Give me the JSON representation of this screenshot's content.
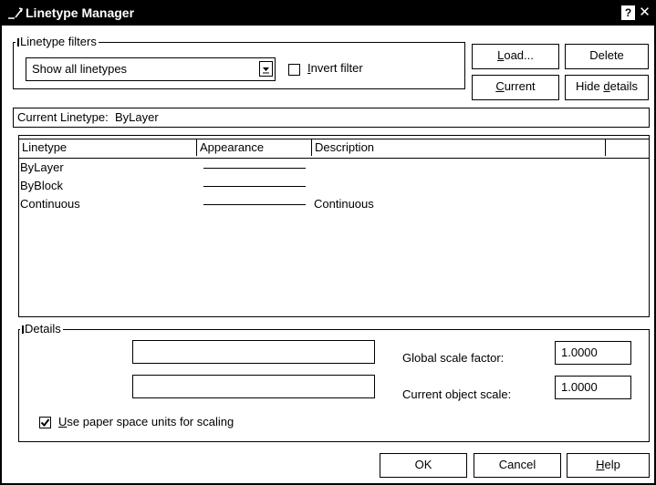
{
  "window": {
    "title": "Linetype Manager",
    "help_glyph": "?",
    "close_glyph": "✕"
  },
  "filters": {
    "legend": "Linetype filters",
    "selected": "Show all linetypes",
    "invert_label_first": "I",
    "invert_label_rest": "nvert filter",
    "invert_checked": false
  },
  "buttons": {
    "load_u": "L",
    "load_rest": "oad...",
    "delete": "Delete",
    "current_u": "C",
    "current_rest": "urrent",
    "hide_details_pre": "Hide ",
    "hide_details_u": "d",
    "hide_details_rest": "etails",
    "ok": "OK",
    "cancel": "Cancel",
    "help_u": "H",
    "help_rest": "elp"
  },
  "current_linetype": {
    "label": "Current Linetype:",
    "value": "ByLayer"
  },
  "list": {
    "columns": [
      "Linetype",
      "Appearance",
      "Description",
      ""
    ],
    "rows": [
      {
        "name": "ByLayer",
        "description": ""
      },
      {
        "name": "ByBlock",
        "description": ""
      },
      {
        "name": "Continuous",
        "description": "Continuous"
      }
    ]
  },
  "details": {
    "legend": "Details",
    "name_value": "",
    "description_value": "",
    "global_scale_label": "Global scale factor:",
    "global_scale_value": "1.0000",
    "object_scale_label": "Current object scale:",
    "object_scale_value": "1.0000",
    "paper_space_u": "U",
    "paper_space_rest": "se paper space units for scaling",
    "paper_space_checked": true
  },
  "icons": {
    "title": "linetype-icon",
    "dropdown": "dropdown-arrow-icon",
    "check": "checkmark-icon"
  }
}
